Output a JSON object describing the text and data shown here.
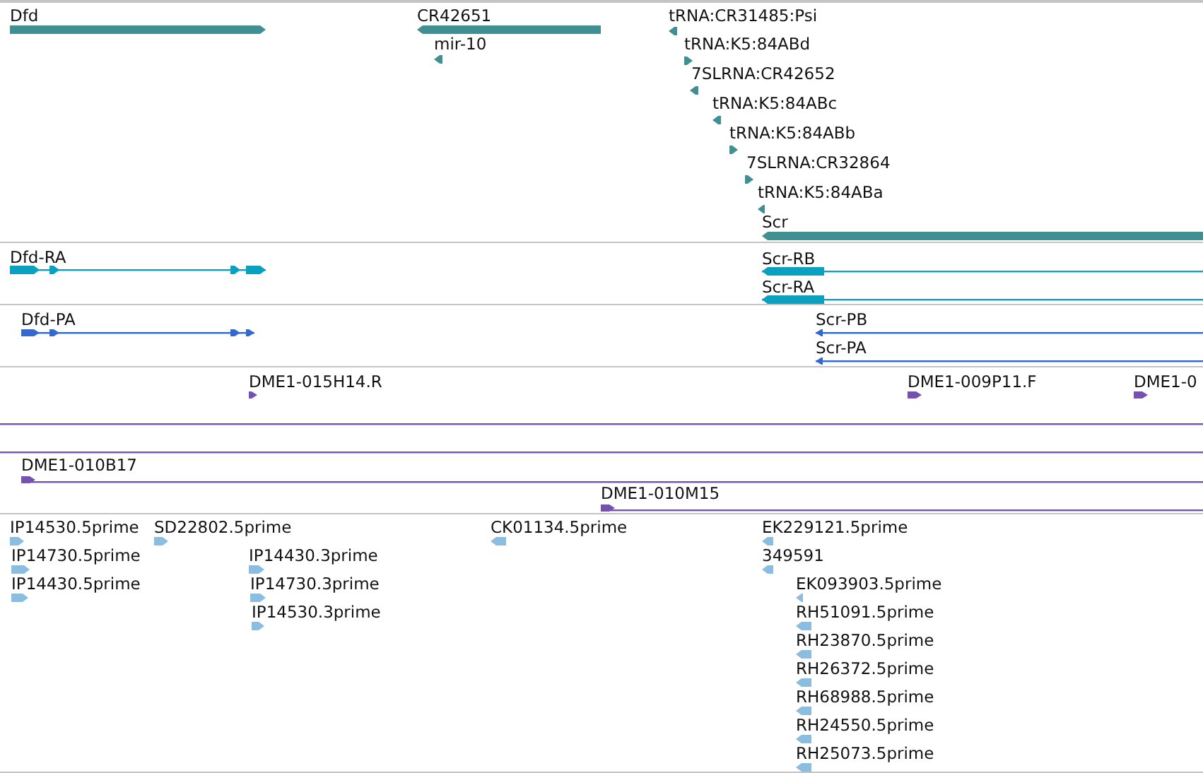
{
  "tracks": [
    {
      "kind": "gene",
      "features": [
        {
          "label": "Dfd",
          "kind": "bar",
          "reverse": false
        },
        {
          "label": "CR42651",
          "kind": "bar",
          "reverse": true
        },
        {
          "label": "tRNA:CR31485:Psi",
          "kind": "bar",
          "reverse": true
        },
        {
          "label": "mir-10",
          "kind": "bar",
          "reverse": true
        },
        {
          "label": "tRNA:K5:84ABd",
          "kind": "bar",
          "reverse": false
        },
        {
          "label": "7SLRNA:CR42652",
          "kind": "bar",
          "reverse": true
        },
        {
          "label": "tRNA:K5:84ABc",
          "kind": "bar",
          "reverse": true
        },
        {
          "label": "tRNA:K5:84ABb",
          "kind": "bar",
          "reverse": false
        },
        {
          "label": "7SLRNA:CR32864",
          "kind": "bar",
          "reverse": false
        },
        {
          "label": "tRNA:K5:84ABa",
          "kind": "bar",
          "reverse": true
        },
        {
          "label": "Scr",
          "kind": "bar",
          "reverse": true
        }
      ]
    },
    {
      "kind": "transcript",
      "features": [
        {
          "label": "Dfd-RA",
          "kind": "model",
          "reverse": false
        },
        {
          "label": "Scr-RB",
          "kind": "model",
          "reverse": true
        },
        {
          "label": "Scr-RA",
          "kind": "model",
          "reverse": true
        }
      ]
    },
    {
      "kind": "protein",
      "features": [
        {
          "label": "Dfd-PA",
          "kind": "model",
          "reverse": false
        },
        {
          "label": "Scr-PB",
          "kind": "model",
          "reverse": true
        },
        {
          "label": "Scr-PA",
          "kind": "model",
          "reverse": true
        }
      ]
    },
    {
      "kind": "clone",
      "features": [
        {
          "label": "DME1-015H14.R",
          "kind": "bar",
          "reverse": false
        },
        {
          "label": "DME1-009P11.F",
          "kind": "bar",
          "reverse": false
        },
        {
          "label": "DME1-0",
          "kind": "bar",
          "reverse": false
        },
        {
          "kind": "span"
        },
        {
          "kind": "span"
        },
        {
          "label": "DME1-010B17",
          "kind": "line",
          "reverse": false
        },
        {
          "label": "DME1-010M15",
          "kind": "line",
          "reverse": false
        }
      ]
    },
    {
      "kind": "est",
      "features": [
        {
          "label": "IP14530.5prime",
          "kind": "bar",
          "reverse": false
        },
        {
          "label": "SD22802.5prime",
          "kind": "bar",
          "reverse": false
        },
        {
          "label": "CK01134.5prime",
          "kind": "bar",
          "reverse": true
        },
        {
          "label": "EK229121.5prime",
          "kind": "bar",
          "reverse": true
        },
        {
          "label": "IP14730.5prime",
          "kind": "bar",
          "reverse": false
        },
        {
          "label": "IP14430.3prime",
          "kind": "bar",
          "reverse": false
        },
        {
          "label": "349591",
          "kind": "bar",
          "reverse": true
        },
        {
          "label": "IP14430.5prime",
          "kind": "bar",
          "reverse": false
        },
        {
          "label": "IP14730.3prime",
          "kind": "bar",
          "reverse": false
        },
        {
          "label": "EK093903.5prime",
          "kind": "bar",
          "reverse": true
        },
        {
          "label": "IP14530.3prime",
          "kind": "bar",
          "reverse": false
        },
        {
          "label": "RH51091.5prime",
          "kind": "bar",
          "reverse": true
        },
        {
          "label": "RH23870.5prime",
          "kind": "bar",
          "reverse": true
        },
        {
          "label": "RH26372.5prime",
          "kind": "bar",
          "reverse": true
        },
        {
          "label": "RH68988.5prime",
          "kind": "bar",
          "reverse": true
        },
        {
          "label": "RH24550.5prime",
          "kind": "bar",
          "reverse": true
        },
        {
          "label": "RH25073.5prime",
          "kind": "bar",
          "reverse": true
        }
      ]
    }
  ]
}
